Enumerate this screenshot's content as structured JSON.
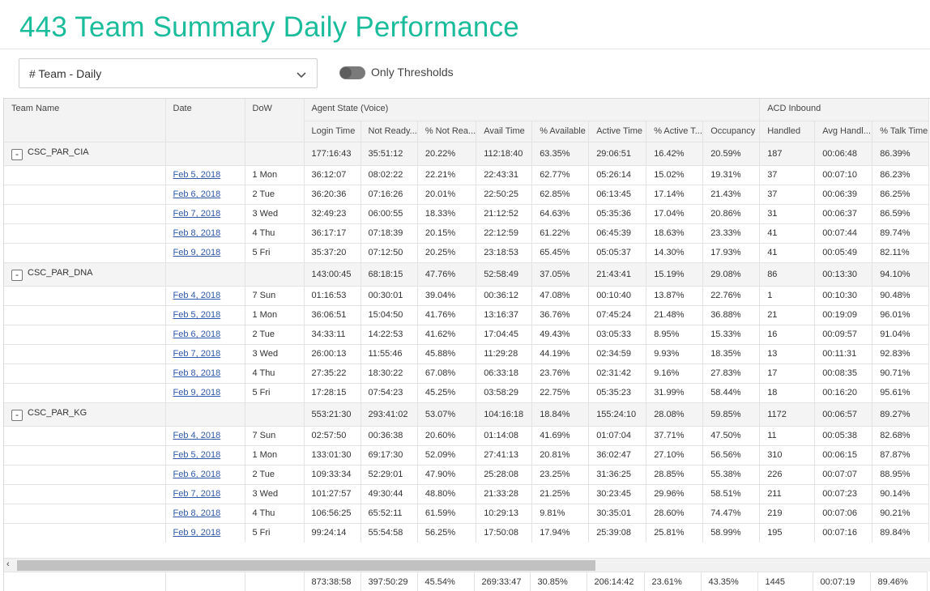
{
  "page": {
    "title": "443 Team Summary Daily Performance"
  },
  "controls": {
    "dropdown_value": "# Team - Daily",
    "toggle_label": "Only Thresholds",
    "toggle_on": false
  },
  "grid": {
    "group_headers": {
      "team_name": "Team Name",
      "date": "Date",
      "dow": "DoW",
      "agent_state": "Agent State (Voice)",
      "acd_inbound": "ACD Inbound"
    },
    "columns": [
      "Login Time",
      "Not Ready...",
      "% Not Rea...",
      "Avail Time",
      "% Available",
      "Active Time",
      "% Active T...",
      "Occupancy",
      "Handled",
      "Avg Handl...",
      "% Talk Time"
    ],
    "groups": [
      {
        "name": "CSC_PAR_CIA",
        "expander": "-",
        "values": [
          "177:16:43",
          "35:51:12",
          "20.22%",
          "112:18:40",
          "63.35%",
          "29:06:51",
          "16.42%",
          "20.59%",
          "187",
          "00:06:48",
          "86.39%"
        ],
        "rows": [
          {
            "date": "Feb 5, 2018",
            "dow": "1 Mon",
            "values": [
              "36:12:07",
              "08:02:22",
              "22.21%",
              "22:43:31",
              "62.77%",
              "05:26:14",
              "15.02%",
              "19.31%",
              "37",
              "00:07:10",
              "86.23%"
            ]
          },
          {
            "date": "Feb 6, 2018",
            "dow": "2 Tue",
            "values": [
              "36:20:36",
              "07:16:26",
              "20.01%",
              "22:50:25",
              "62.85%",
              "06:13:45",
              "17.14%",
              "21.43%",
              "37",
              "00:06:39",
              "86.25%"
            ]
          },
          {
            "date": "Feb 7, 2018",
            "dow": "3 Wed",
            "values": [
              "32:49:23",
              "06:00:55",
              "18.33%",
              "21:12:52",
              "64.63%",
              "05:35:36",
              "17.04%",
              "20.86%",
              "31",
              "00:06:37",
              "86.59%"
            ]
          },
          {
            "date": "Feb 8, 2018",
            "dow": "4 Thu",
            "values": [
              "36:17:17",
              "07:18:39",
              "20.15%",
              "22:12:59",
              "61.22%",
              "06:45:39",
              "18.63%",
              "23.33%",
              "41",
              "00:07:44",
              "89.74%"
            ]
          },
          {
            "date": "Feb 9, 2018",
            "dow": "5 Fri",
            "values": [
              "35:37:20",
              "07:12:50",
              "20.25%",
              "23:18:53",
              "65.45%",
              "05:05:37",
              "14.30%",
              "17.93%",
              "41",
              "00:05:49",
              "82.11%"
            ]
          }
        ]
      },
      {
        "name": "CSC_PAR_DNA",
        "expander": "-",
        "values": [
          "143:00:45",
          "68:18:15",
          "47.76%",
          "52:58:49",
          "37.05%",
          "21:43:41",
          "15.19%",
          "29.08%",
          "86",
          "00:13:30",
          "94.10%"
        ],
        "rows": [
          {
            "date": "Feb 4, 2018",
            "dow": "7 Sun",
            "values": [
              "01:16:53",
              "00:30:01",
              "39.04%",
              "00:36:12",
              "47.08%",
              "00:10:40",
              "13.87%",
              "22.76%",
              "1",
              "00:10:30",
              "90.48%"
            ]
          },
          {
            "date": "Feb 5, 2018",
            "dow": "1 Mon",
            "values": [
              "36:06:51",
              "15:04:50",
              "41.76%",
              "13:16:37",
              "36.76%",
              "07:45:24",
              "21.48%",
              "36.88%",
              "21",
              "00:19:09",
              "96.01%"
            ]
          },
          {
            "date": "Feb 6, 2018",
            "dow": "2 Tue",
            "values": [
              "34:33:11",
              "14:22:53",
              "41.62%",
              "17:04:45",
              "49.43%",
              "03:05:33",
              "8.95%",
              "15.33%",
              "16",
              "00:09:57",
              "91.04%"
            ]
          },
          {
            "date": "Feb 7, 2018",
            "dow": "3 Wed",
            "values": [
              "26:00:13",
              "11:55:46",
              "45.88%",
              "11:29:28",
              "44.19%",
              "02:34:59",
              "9.93%",
              "18.35%",
              "13",
              "00:11:31",
              "92.83%"
            ]
          },
          {
            "date": "Feb 8, 2018",
            "dow": "4 Thu",
            "values": [
              "27:35:22",
              "18:30:22",
              "67.08%",
              "06:33:18",
              "23.76%",
              "02:31:42",
              "9.16%",
              "27.83%",
              "17",
              "00:08:35",
              "90.71%"
            ]
          },
          {
            "date": "Feb 9, 2018",
            "dow": "5 Fri",
            "values": [
              "17:28:15",
              "07:54:23",
              "45.25%",
              "03:58:29",
              "22.75%",
              "05:35:23",
              "31.99%",
              "58.44%",
              "18",
              "00:16:20",
              "95.61%"
            ]
          }
        ]
      },
      {
        "name": "CSC_PAR_KG",
        "expander": "-",
        "values": [
          "553:21:30",
          "293:41:02",
          "53.07%",
          "104:16:18",
          "18.84%",
          "155:24:10",
          "28.08%",
          "59.85%",
          "1172",
          "00:06:57",
          "89.27%"
        ],
        "rows": [
          {
            "date": "Feb 4, 2018",
            "dow": "7 Sun",
            "values": [
              "02:57:50",
              "00:36:38",
              "20.60%",
              "01:14:08",
              "41.69%",
              "01:07:04",
              "37.71%",
              "47.50%",
              "11",
              "00:05:38",
              "82.68%"
            ]
          },
          {
            "date": "Feb 5, 2018",
            "dow": "1 Mon",
            "values": [
              "133:01:30",
              "69:17:30",
              "52.09%",
              "27:41:13",
              "20.81%",
              "36:02:47",
              "27.10%",
              "56.56%",
              "310",
              "00:06:15",
              "87.87%"
            ]
          },
          {
            "date": "Feb 6, 2018",
            "dow": "2 Tue",
            "values": [
              "109:33:34",
              "52:29:01",
              "47.90%",
              "25:28:08",
              "23.25%",
              "31:36:25",
              "28.85%",
              "55.38%",
              "226",
              "00:07:07",
              "88.95%"
            ]
          },
          {
            "date": "Feb 7, 2018",
            "dow": "3 Wed",
            "values": [
              "101:27:57",
              "49:30:44",
              "48.80%",
              "21:33:28",
              "21.25%",
              "30:23:45",
              "29.96%",
              "58.51%",
              "211",
              "00:07:23",
              "90.14%"
            ]
          },
          {
            "date": "Feb 8, 2018",
            "dow": "4 Thu",
            "values": [
              "106:56:25",
              "65:52:11",
              "61.59%",
              "10:29:13",
              "9.81%",
              "30:35:01",
              "28.60%",
              "74.47%",
              "219",
              "00:07:06",
              "90.21%"
            ]
          },
          {
            "date": "Feb 9, 2018",
            "dow": "5 Fri",
            "values": [
              "99:24:14",
              "55:54:58",
              "56.25%",
              "17:50:08",
              "17.94%",
              "25:39:08",
              "25.81%",
              "58.99%",
              "195",
              "00:07:16",
              "89.84%"
            ]
          }
        ]
      }
    ],
    "totals": [
      "873:38:58",
      "397:50:29",
      "45.54%",
      "269:33:47",
      "30.85%",
      "206:14:42",
      "23.61%",
      "43.35%",
      "1445",
      "00:07:19",
      "89.46%"
    ],
    "scroll_left_icon": "chevron-left-icon",
    "scroll_arrow_glyph": "‹"
  },
  "colors": {
    "title": "#1bbc9b",
    "link": "#2f58a8",
    "header_bg": "#f3f3f3",
    "group_bg": "#f4f4f4"
  }
}
